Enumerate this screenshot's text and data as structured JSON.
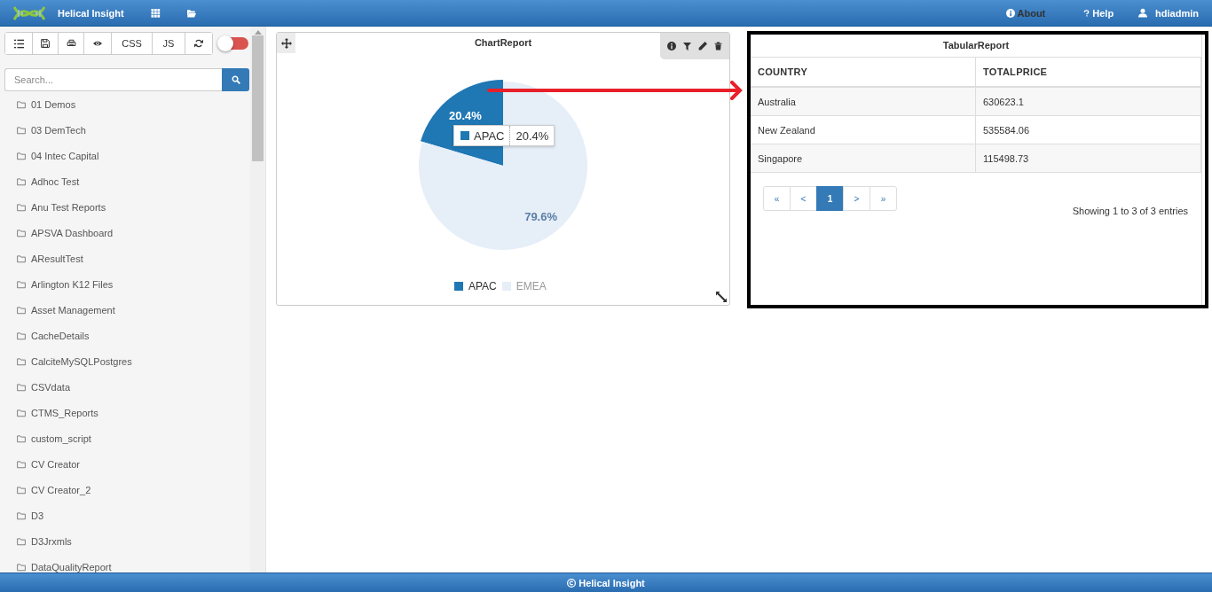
{
  "header": {
    "title": "Helical Insight",
    "links": [
      {
        "kind": "info",
        "label": "About"
      },
      {
        "kind": "help",
        "label": "Help"
      },
      {
        "kind": "user",
        "label": "hdiadmin"
      }
    ]
  },
  "sidebar": {
    "toolbar": [
      {
        "kind": "list"
      },
      {
        "kind": "save"
      },
      {
        "kind": "print"
      },
      {
        "kind": "eye"
      },
      {
        "kind": "text",
        "label": "CSS"
      },
      {
        "kind": "text",
        "label": "JS"
      },
      {
        "kind": "refresh"
      }
    ],
    "toggle": {
      "on": false
    },
    "search": {
      "placeholder": "Search..."
    },
    "items": [
      "01 Demos",
      "03 DemTech",
      "04 Intec Capital",
      "Adhoc Test",
      "Anu Test Reports",
      "APSVA Dashboard",
      "AResultTest",
      "Arlington K12 Files",
      "Asset Management",
      "CacheDetails",
      "CalciteMySQLPostgres",
      "CSVdata",
      "CTMS_Reports",
      "custom_script",
      "CV Creator",
      "CV Creator_2",
      "D3",
      "D3Jrxmls",
      "DataQualityReport"
    ]
  },
  "chart_report": {
    "title": "ChartReport",
    "tooltip": {
      "label": "APAC",
      "value": "20.4%"
    },
    "chart_data": {
      "type": "pie",
      "categories": [
        "APAC",
        "EMEA"
      ],
      "series": [
        {
          "colors": [
            "#1f77b4",
            "#e6eef8"
          ],
          "values": [
            20.4,
            79.6
          ]
        }
      ],
      "value_labels": [
        "20.4%",
        "79.6%"
      ]
    },
    "legend": [
      {
        "selected": true
      },
      {
        "selected": false
      }
    ]
  },
  "tabular_report": {
    "title": "TabularReport",
    "columns": [
      "COUNTRY",
      "TOTALPRICE"
    ],
    "rows": [
      [
        "Australia",
        "630623.1"
      ],
      [
        "New Zealand",
        "535584.06"
      ],
      [
        "Singapore",
        "115498.73"
      ]
    ],
    "pagination": [
      {
        "label": "«",
        "selected": false
      },
      {
        "label": "<",
        "selected": false
      },
      {
        "label": "1",
        "selected": true
      },
      {
        "label": ">",
        "selected": false
      },
      {
        "label": "»",
        "selected": false
      }
    ],
    "info": "Showing 1 to 3 of 3 entries"
  },
  "footer": {
    "text": "Helical Insight"
  }
}
